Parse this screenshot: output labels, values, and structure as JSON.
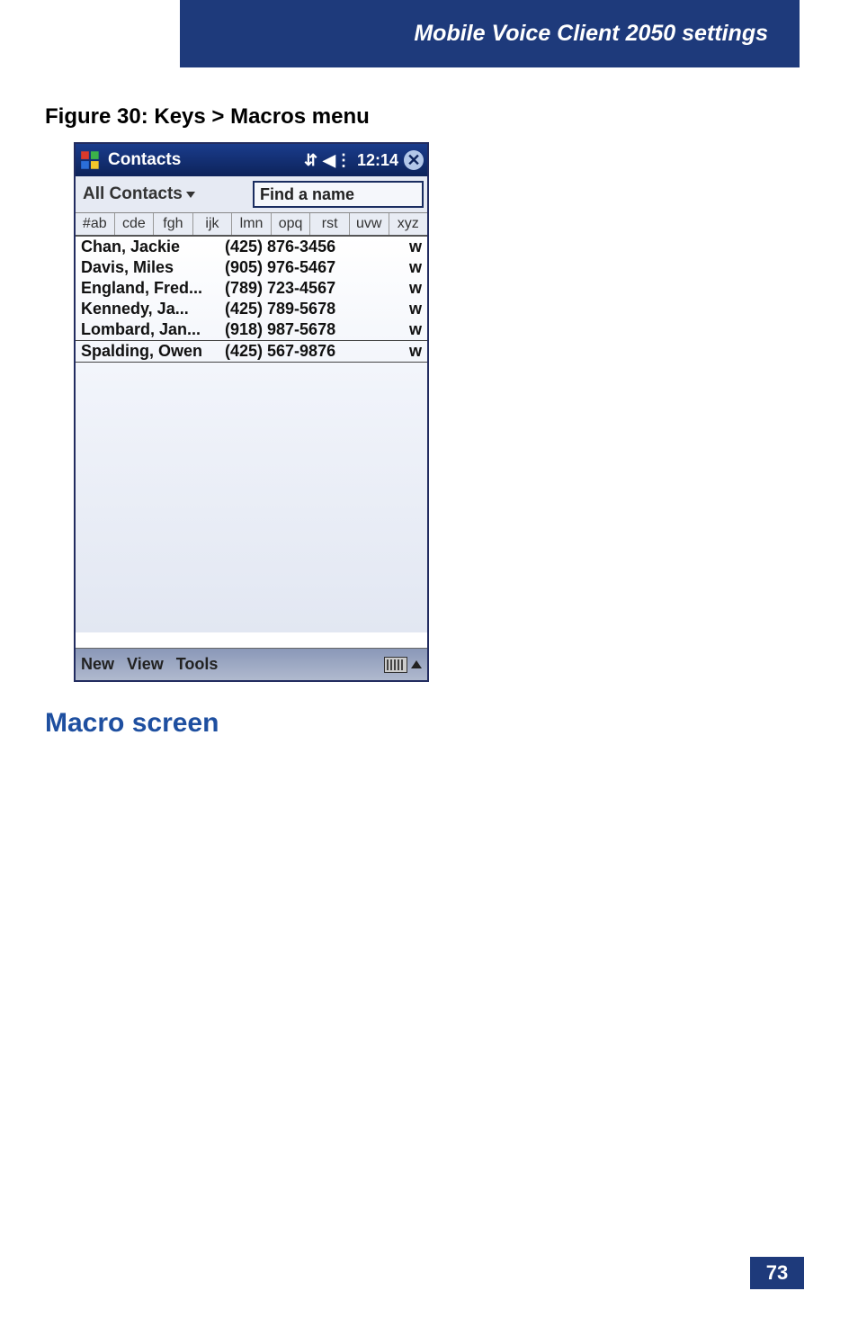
{
  "page": {
    "running_header": "Mobile Voice Client 2050 settings",
    "figure_caption": "Figure 30: Keys > Macros menu",
    "section_heading": "Macro screen",
    "page_number": "73"
  },
  "screenshot": {
    "nav": {
      "title": "Contacts",
      "time": "12:14"
    },
    "filter": {
      "category_label": "All Contacts",
      "search_placeholder": "Find a name"
    },
    "alpha_tabs": [
      "#ab",
      "cde",
      "fgh",
      "ijk",
      "lmn",
      "opq",
      "rst",
      "uvw",
      "xyz"
    ],
    "contacts": [
      {
        "name": "Chan, Jackie",
        "phone": "(425) 876-3456",
        "type": "w",
        "selected": false
      },
      {
        "name": "Davis, Miles",
        "phone": "(905) 976-5467",
        "type": "w",
        "selected": false
      },
      {
        "name": "England, Fred...",
        "phone": "(789) 723-4567",
        "type": "w",
        "selected": false
      },
      {
        "name": "Kennedy, Ja...",
        "phone": "(425) 789-5678",
        "type": "w",
        "selected": false
      },
      {
        "name": "Lombard, Jan...",
        "phone": "(918) 987-5678",
        "type": "w",
        "selected": false
      },
      {
        "name": "Spalding, Owen",
        "phone": "(425) 567-9876",
        "type": "w",
        "selected": true
      }
    ],
    "menu": {
      "items": [
        "New",
        "View",
        "Tools"
      ]
    }
  }
}
